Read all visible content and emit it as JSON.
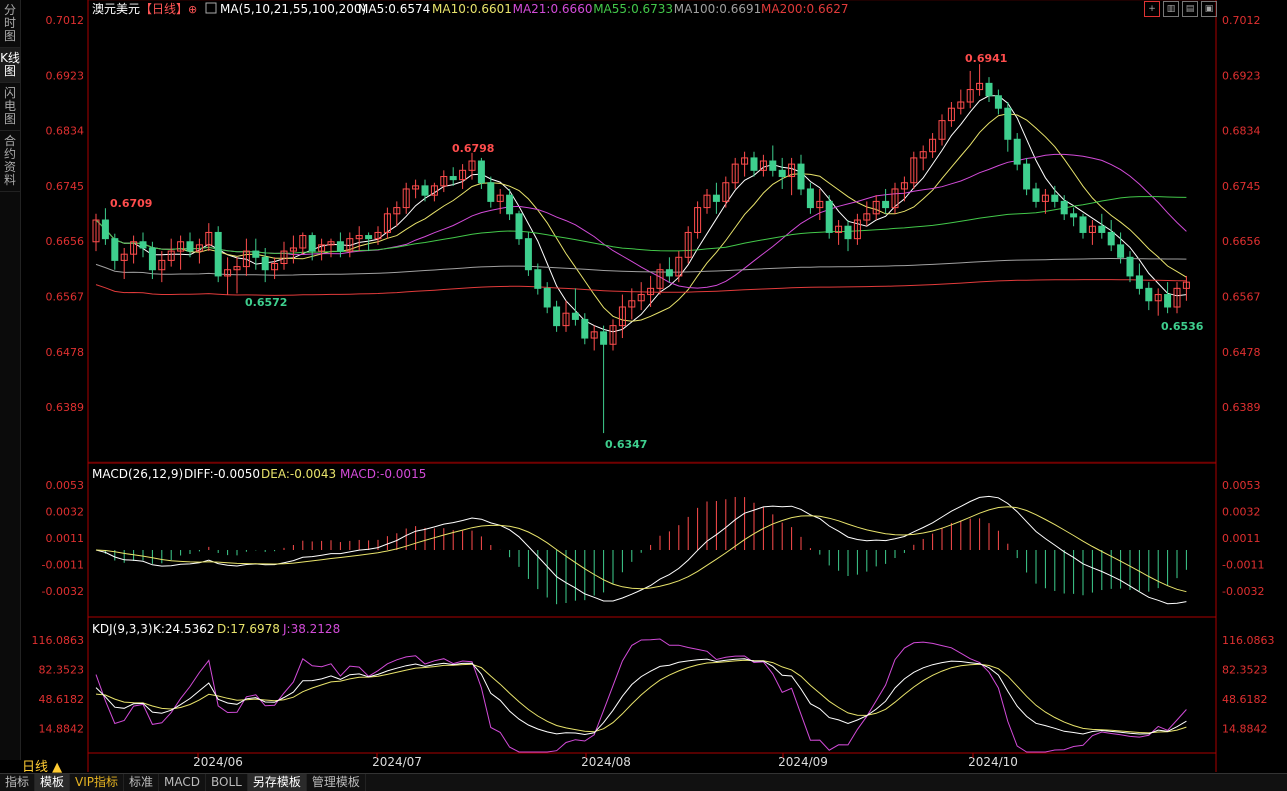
{
  "sidebar": {
    "tabs": [
      "分时图",
      "K线图",
      "闪电图",
      "合约资料"
    ],
    "active": 1
  },
  "header": {
    "symbol": "澳元美元",
    "period": "【日线】",
    "ma_params": "MA(5,10,21,55,100,200)",
    "ma": [
      {
        "label": "MA5:0.6574",
        "color": "#ffffff"
      },
      {
        "label": "MA10:0.6601",
        "color": "#e8e36b"
      },
      {
        "label": "MA21:0.6660",
        "color": "#d24bd8"
      },
      {
        "label": "MA55:0.6733",
        "color": "#43c84a"
      },
      {
        "label": "MA100:0.6691",
        "color": "#a0a0a0"
      },
      {
        "label": "MA200:0.6627",
        "color": "#e23b3b"
      }
    ]
  },
  "price_axis": [
    "0.7012",
    "0.6923",
    "0.6834",
    "0.6745",
    "0.6656",
    "0.6567",
    "0.6478",
    "0.6389"
  ],
  "annotations": {
    "high1": "0.6709",
    "high2": "0.6798",
    "high3": "0.6941",
    "low1": "0.6572",
    "low2": "0.6347",
    "low3": "0.6536"
  },
  "macd": {
    "title": "MACD(26,12,9)",
    "diff": "DIFF:-0.0050",
    "dea": "DEA:-0.0043",
    "macd": "MACD:-0.0015",
    "axis": [
      "0.0053",
      "0.0032",
      "0.0011",
      "-0.0011",
      "-0.0032"
    ]
  },
  "kdj": {
    "title": "KDJ(9,3,3)",
    "k": "K:24.5362",
    "d": "D:17.6978",
    "j": "J:38.2128",
    "axis": [
      "116.0863",
      "82.3523",
      "48.6182",
      "14.8842"
    ]
  },
  "time_axis": [
    "2024/06",
    "2024/07",
    "2024/08",
    "2024/09",
    "2024/10"
  ],
  "period_button": "日线",
  "bottom_tabs": [
    "指标",
    "模板",
    "VIP指标",
    "标准",
    "MACD",
    "BOLL",
    "另存模板",
    "管理模板"
  ],
  "colors": {
    "up": "#ff4d4d",
    "down": "#3ecf8e",
    "axis": "#e03030"
  },
  "chart_data": {
    "type": "candlestick",
    "x": [
      "2024-05-21",
      "2024-05-22",
      "2024-05-23",
      "2024-05-24",
      "2024-05-27",
      "2024-05-28",
      "2024-05-29",
      "2024-05-30",
      "2024-05-31",
      "2024-06-03",
      "2024-06-04",
      "2024-06-05",
      "2024-06-06",
      "2024-06-07",
      "2024-06-10",
      "2024-06-11",
      "2024-06-12",
      "2024-06-13",
      "2024-06-14",
      "2024-06-17",
      "2024-06-18",
      "2024-06-19",
      "2024-06-20",
      "2024-06-21",
      "2024-06-24",
      "2024-06-25",
      "2024-06-26",
      "2024-06-27",
      "2024-06-28",
      "2024-07-01",
      "2024-07-02",
      "2024-07-03",
      "2024-07-04",
      "2024-07-05",
      "2024-07-08",
      "2024-07-09",
      "2024-07-10",
      "2024-07-11",
      "2024-07-12",
      "2024-07-15",
      "2024-07-16",
      "2024-07-17",
      "2024-07-18",
      "2024-07-19",
      "2024-07-22",
      "2024-07-23",
      "2024-07-24",
      "2024-07-25",
      "2024-07-26",
      "2024-07-29",
      "2024-07-30",
      "2024-07-31",
      "2024-08-01",
      "2024-08-02",
      "2024-08-05",
      "2024-08-06",
      "2024-08-07",
      "2024-08-08",
      "2024-08-09",
      "2024-08-12",
      "2024-08-13",
      "2024-08-14",
      "2024-08-15",
      "2024-08-16",
      "2024-08-19",
      "2024-08-20",
      "2024-08-21",
      "2024-08-22",
      "2024-08-23",
      "2024-08-26",
      "2024-08-27",
      "2024-08-28",
      "2024-08-29",
      "2024-08-30",
      "2024-09-02",
      "2024-09-03",
      "2024-09-04",
      "2024-09-05",
      "2024-09-06",
      "2024-09-09",
      "2024-09-10",
      "2024-09-11",
      "2024-09-12",
      "2024-09-13",
      "2024-09-16",
      "2024-09-17",
      "2024-09-18",
      "2024-09-19",
      "2024-09-20",
      "2024-09-23",
      "2024-09-24",
      "2024-09-25",
      "2024-09-26",
      "2024-09-27",
      "2024-09-30",
      "2024-10-01",
      "2024-10-02",
      "2024-10-03",
      "2024-10-04",
      "2024-10-07",
      "2024-10-08",
      "2024-10-09",
      "2024-10-10",
      "2024-10-11",
      "2024-10-14",
      "2024-10-15",
      "2024-10-16",
      "2024-10-17",
      "2024-10-18",
      "2024-10-21",
      "2024-10-22",
      "2024-10-23",
      "2024-10-24",
      "2024-10-25",
      "2024-10-28",
      "2024-10-29",
      "2024-10-30"
    ],
    "ohlc": [
      [
        0.6655,
        0.67,
        0.664,
        0.669
      ],
      [
        0.669,
        0.6709,
        0.665,
        0.666
      ],
      [
        0.666,
        0.6668,
        0.661,
        0.6625
      ],
      [
        0.6625,
        0.6645,
        0.6595,
        0.6635
      ],
      [
        0.6635,
        0.6665,
        0.662,
        0.6655
      ],
      [
        0.6655,
        0.667,
        0.663,
        0.6645
      ],
      [
        0.6645,
        0.6655,
        0.6595,
        0.661
      ],
      [
        0.661,
        0.664,
        0.659,
        0.6625
      ],
      [
        0.6625,
        0.666,
        0.6615,
        0.664
      ],
      [
        0.664,
        0.6665,
        0.661,
        0.6655
      ],
      [
        0.6655,
        0.667,
        0.663,
        0.664
      ],
      [
        0.664,
        0.666,
        0.662,
        0.665
      ],
      [
        0.665,
        0.6685,
        0.664,
        0.667
      ],
      [
        0.667,
        0.668,
        0.659,
        0.66
      ],
      [
        0.66,
        0.663,
        0.657,
        0.661
      ],
      [
        0.661,
        0.663,
        0.6572,
        0.6615
      ],
      [
        0.6615,
        0.666,
        0.66,
        0.664
      ],
      [
        0.664,
        0.666,
        0.661,
        0.663
      ],
      [
        0.663,
        0.6645,
        0.659,
        0.661
      ],
      [
        0.661,
        0.663,
        0.6595,
        0.662
      ],
      [
        0.662,
        0.6655,
        0.661,
        0.664
      ],
      [
        0.664,
        0.6665,
        0.662,
        0.6645
      ],
      [
        0.6645,
        0.667,
        0.6635,
        0.6665
      ],
      [
        0.6665,
        0.667,
        0.6625,
        0.664
      ],
      [
        0.664,
        0.666,
        0.6625,
        0.665
      ],
      [
        0.665,
        0.666,
        0.663,
        0.6655
      ],
      [
        0.6655,
        0.667,
        0.663,
        0.664
      ],
      [
        0.664,
        0.667,
        0.663,
        0.666
      ],
      [
        0.666,
        0.668,
        0.664,
        0.6665
      ],
      [
        0.6665,
        0.667,
        0.664,
        0.666
      ],
      [
        0.666,
        0.668,
        0.665,
        0.667
      ],
      [
        0.667,
        0.671,
        0.666,
        0.67
      ],
      [
        0.67,
        0.672,
        0.668,
        0.671
      ],
      [
        0.671,
        0.675,
        0.67,
        0.674
      ],
      [
        0.674,
        0.6755,
        0.6725,
        0.6745
      ],
      [
        0.6745,
        0.6755,
        0.672,
        0.673
      ],
      [
        0.673,
        0.675,
        0.672,
        0.6745
      ],
      [
        0.6745,
        0.677,
        0.6735,
        0.676
      ],
      [
        0.676,
        0.6775,
        0.6745,
        0.6755
      ],
      [
        0.6755,
        0.678,
        0.674,
        0.677
      ],
      [
        0.677,
        0.6798,
        0.6755,
        0.6785
      ],
      [
        0.6785,
        0.679,
        0.674,
        0.675
      ],
      [
        0.675,
        0.676,
        0.671,
        0.672
      ],
      [
        0.672,
        0.674,
        0.67,
        0.673
      ],
      [
        0.673,
        0.674,
        0.669,
        0.67
      ],
      [
        0.67,
        0.6705,
        0.665,
        0.666
      ],
      [
        0.666,
        0.667,
        0.66,
        0.661
      ],
      [
        0.661,
        0.662,
        0.657,
        0.658
      ],
      [
        0.658,
        0.659,
        0.654,
        0.655
      ],
      [
        0.655,
        0.656,
        0.651,
        0.652
      ],
      [
        0.652,
        0.656,
        0.651,
        0.654
      ],
      [
        0.654,
        0.658,
        0.652,
        0.653
      ],
      [
        0.653,
        0.654,
        0.649,
        0.65
      ],
      [
        0.65,
        0.652,
        0.648,
        0.651
      ],
      [
        0.651,
        0.652,
        0.6347,
        0.649
      ],
      [
        0.649,
        0.653,
        0.648,
        0.652
      ],
      [
        0.652,
        0.657,
        0.65,
        0.655
      ],
      [
        0.655,
        0.658,
        0.653,
        0.656
      ],
      [
        0.656,
        0.659,
        0.6545,
        0.657
      ],
      [
        0.657,
        0.66,
        0.655,
        0.658
      ],
      [
        0.658,
        0.662,
        0.657,
        0.661
      ],
      [
        0.661,
        0.663,
        0.659,
        0.66
      ],
      [
        0.66,
        0.664,
        0.659,
        0.663
      ],
      [
        0.663,
        0.668,
        0.662,
        0.667
      ],
      [
        0.667,
        0.672,
        0.666,
        0.671
      ],
      [
        0.671,
        0.674,
        0.67,
        0.673
      ],
      [
        0.673,
        0.675,
        0.67,
        0.672
      ],
      [
        0.672,
        0.676,
        0.671,
        0.675
      ],
      [
        0.675,
        0.679,
        0.674,
        0.678
      ],
      [
        0.678,
        0.68,
        0.676,
        0.679
      ],
      [
        0.679,
        0.68,
        0.676,
        0.677
      ],
      [
        0.677,
        0.6795,
        0.676,
        0.6785
      ],
      [
        0.6785,
        0.681,
        0.676,
        0.677
      ],
      [
        0.677,
        0.679,
        0.674,
        0.676
      ],
      [
        0.676,
        0.679,
        0.673,
        0.678
      ],
      [
        0.678,
        0.6795,
        0.673,
        0.674
      ],
      [
        0.674,
        0.675,
        0.67,
        0.671
      ],
      [
        0.671,
        0.674,
        0.669,
        0.672
      ],
      [
        0.672,
        0.673,
        0.666,
        0.667
      ],
      [
        0.667,
        0.669,
        0.665,
        0.668
      ],
      [
        0.668,
        0.669,
        0.664,
        0.666
      ],
      [
        0.666,
        0.67,
        0.665,
        0.669
      ],
      [
        0.669,
        0.672,
        0.668,
        0.67
      ],
      [
        0.67,
        0.673,
        0.669,
        0.672
      ],
      [
        0.672,
        0.674,
        0.67,
        0.671
      ],
      [
        0.671,
        0.675,
        0.67,
        0.674
      ],
      [
        0.674,
        0.676,
        0.672,
        0.675
      ],
      [
        0.675,
        0.68,
        0.674,
        0.679
      ],
      [
        0.679,
        0.681,
        0.677,
        0.68
      ],
      [
        0.68,
        0.683,
        0.679,
        0.682
      ],
      [
        0.682,
        0.686,
        0.681,
        0.685
      ],
      [
        0.685,
        0.688,
        0.684,
        0.687
      ],
      [
        0.687,
        0.69,
        0.686,
        0.688
      ],
      [
        0.688,
        0.693,
        0.687,
        0.69
      ],
      [
        0.69,
        0.6941,
        0.689,
        0.691
      ],
      [
        0.691,
        0.692,
        0.688,
        0.689
      ],
      [
        0.689,
        0.69,
        0.686,
        0.687
      ],
      [
        0.687,
        0.688,
        0.68,
        0.682
      ],
      [
        0.682,
        0.683,
        0.677,
        0.678
      ],
      [
        0.678,
        0.679,
        0.673,
        0.674
      ],
      [
        0.674,
        0.675,
        0.671,
        0.672
      ],
      [
        0.672,
        0.674,
        0.67,
        0.673
      ],
      [
        0.673,
        0.6745,
        0.671,
        0.672
      ],
      [
        0.672,
        0.673,
        0.669,
        0.67
      ],
      [
        0.67,
        0.671,
        0.668,
        0.6695
      ],
      [
        0.6695,
        0.67,
        0.666,
        0.667
      ],
      [
        0.667,
        0.669,
        0.665,
        0.668
      ],
      [
        0.668,
        0.67,
        0.666,
        0.667
      ],
      [
        0.667,
        0.669,
        0.664,
        0.665
      ],
      [
        0.665,
        0.667,
        0.662,
        0.663
      ],
      [
        0.663,
        0.664,
        0.659,
        0.66
      ],
      [
        0.66,
        0.662,
        0.657,
        0.658
      ],
      [
        0.658,
        0.659,
        0.6545,
        0.656
      ],
      [
        0.656,
        0.658,
        0.6536,
        0.657
      ],
      [
        0.657,
        0.659,
        0.654,
        0.655
      ],
      [
        0.655,
        0.659,
        0.654,
        0.658
      ],
      [
        0.658,
        0.66,
        0.656,
        0.659
      ]
    ],
    "ylim": [
      0.63,
      0.7012
    ]
  }
}
